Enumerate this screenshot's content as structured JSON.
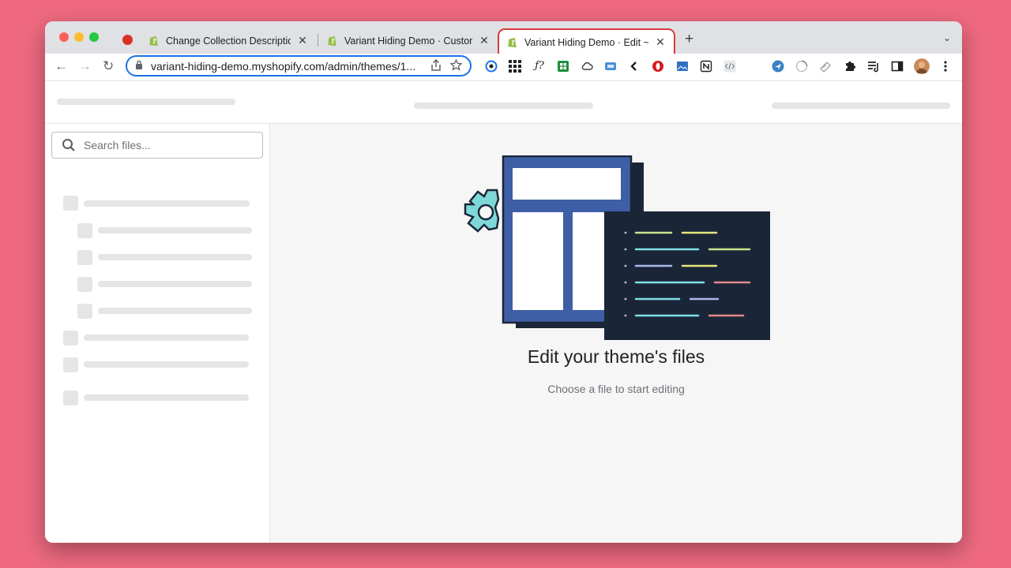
{
  "browser": {
    "tabs": [
      {
        "title": "Change Collection Description",
        "active": false
      },
      {
        "title": "Variant Hiding Demo · Customi",
        "active": false
      },
      {
        "title": "Variant Hiding Demo · Edit ~ th",
        "active": true
      }
    ],
    "close_glyph": "✕",
    "new_tab_glyph": "+",
    "tab_menu_glyph": "⌄",
    "url": "variant-hiding-demo.myshopify.com/admin/themes/1...",
    "nav": {
      "back": "←",
      "forward": "→",
      "reload": "↻"
    },
    "extensions": [
      "lastpass-icon",
      "apps-grid-icon",
      "formula-icon",
      "sheets-icon",
      "cloud-icon",
      "screen-icon",
      "chevron-left-icon",
      "opera-icon",
      "image-icon",
      "notion-icon",
      "code-icon",
      "plane-icon",
      "loading-icon",
      "stamp-icon",
      "puzzle-icon",
      "playlist-icon",
      "sidepanel-icon",
      "profile-avatar",
      "menu-icon"
    ],
    "colors": {
      "accent": "#1a73e8",
      "active_tab_border": "#d93a3a",
      "tab_strip": "#dfe1e5",
      "background": "#ef6a80"
    }
  },
  "editor": {
    "search": {
      "placeholder": "Search files..."
    },
    "empty_state": {
      "title": "Edit your theme's files",
      "subtitle": "Choose a file to start editing"
    }
  }
}
